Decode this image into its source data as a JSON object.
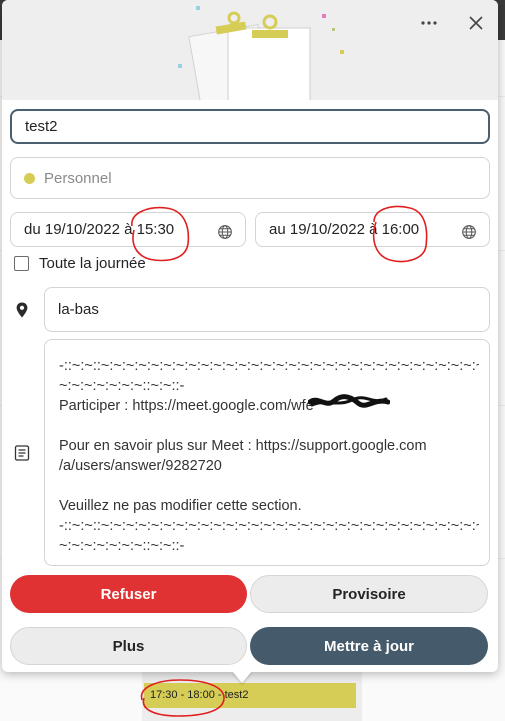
{
  "popup": {
    "more_icon": "ellipsis-icon",
    "close_icon": "close-icon"
  },
  "event": {
    "title": "test2",
    "category": "Personnel",
    "category_color": "#d6cd56",
    "start": "du 19/10/2022 à 15:30",
    "end": "au 19/10/2022 à 16:00",
    "all_day_label": "Toute la journée",
    "location": "la-bas",
    "description": [
      "-::~:~::~:~:~:~:~:~:~:~:~:~:~:~:~:~:~:~:~:~:~:~:~:~:~:~:~:~:~:~:~:~:~:~:~:~:",
      "~:~:~:~:~:~:~::~:~::-",
      "Participer : https://meet.google.com/wfe",
      "",
      "Pour en savoir plus sur Meet : https://support.google.com",
      "/a/users/answer/9282720",
      "",
      "Veuillez ne pas modifier cette section.",
      "-::~:~::~:~:~:~:~:~:~:~:~:~:~:~:~:~:~:~:~:~:~:~:~:~:~:~:~:~:~:~:~:~:~:~:~:~:",
      "~:~:~:~:~:~:~::~:~::-"
    ]
  },
  "actions": {
    "refuse": "Refuser",
    "tentative": "Provisoire",
    "more": "Plus",
    "update": "Mettre à jour"
  },
  "background_event": {
    "label": "17:30 - 18:00 - test2",
    "color": "#d6cd56"
  },
  "colors": {
    "refuse": "#e03232",
    "update": "#455a6a",
    "annotation": "#e02020"
  }
}
